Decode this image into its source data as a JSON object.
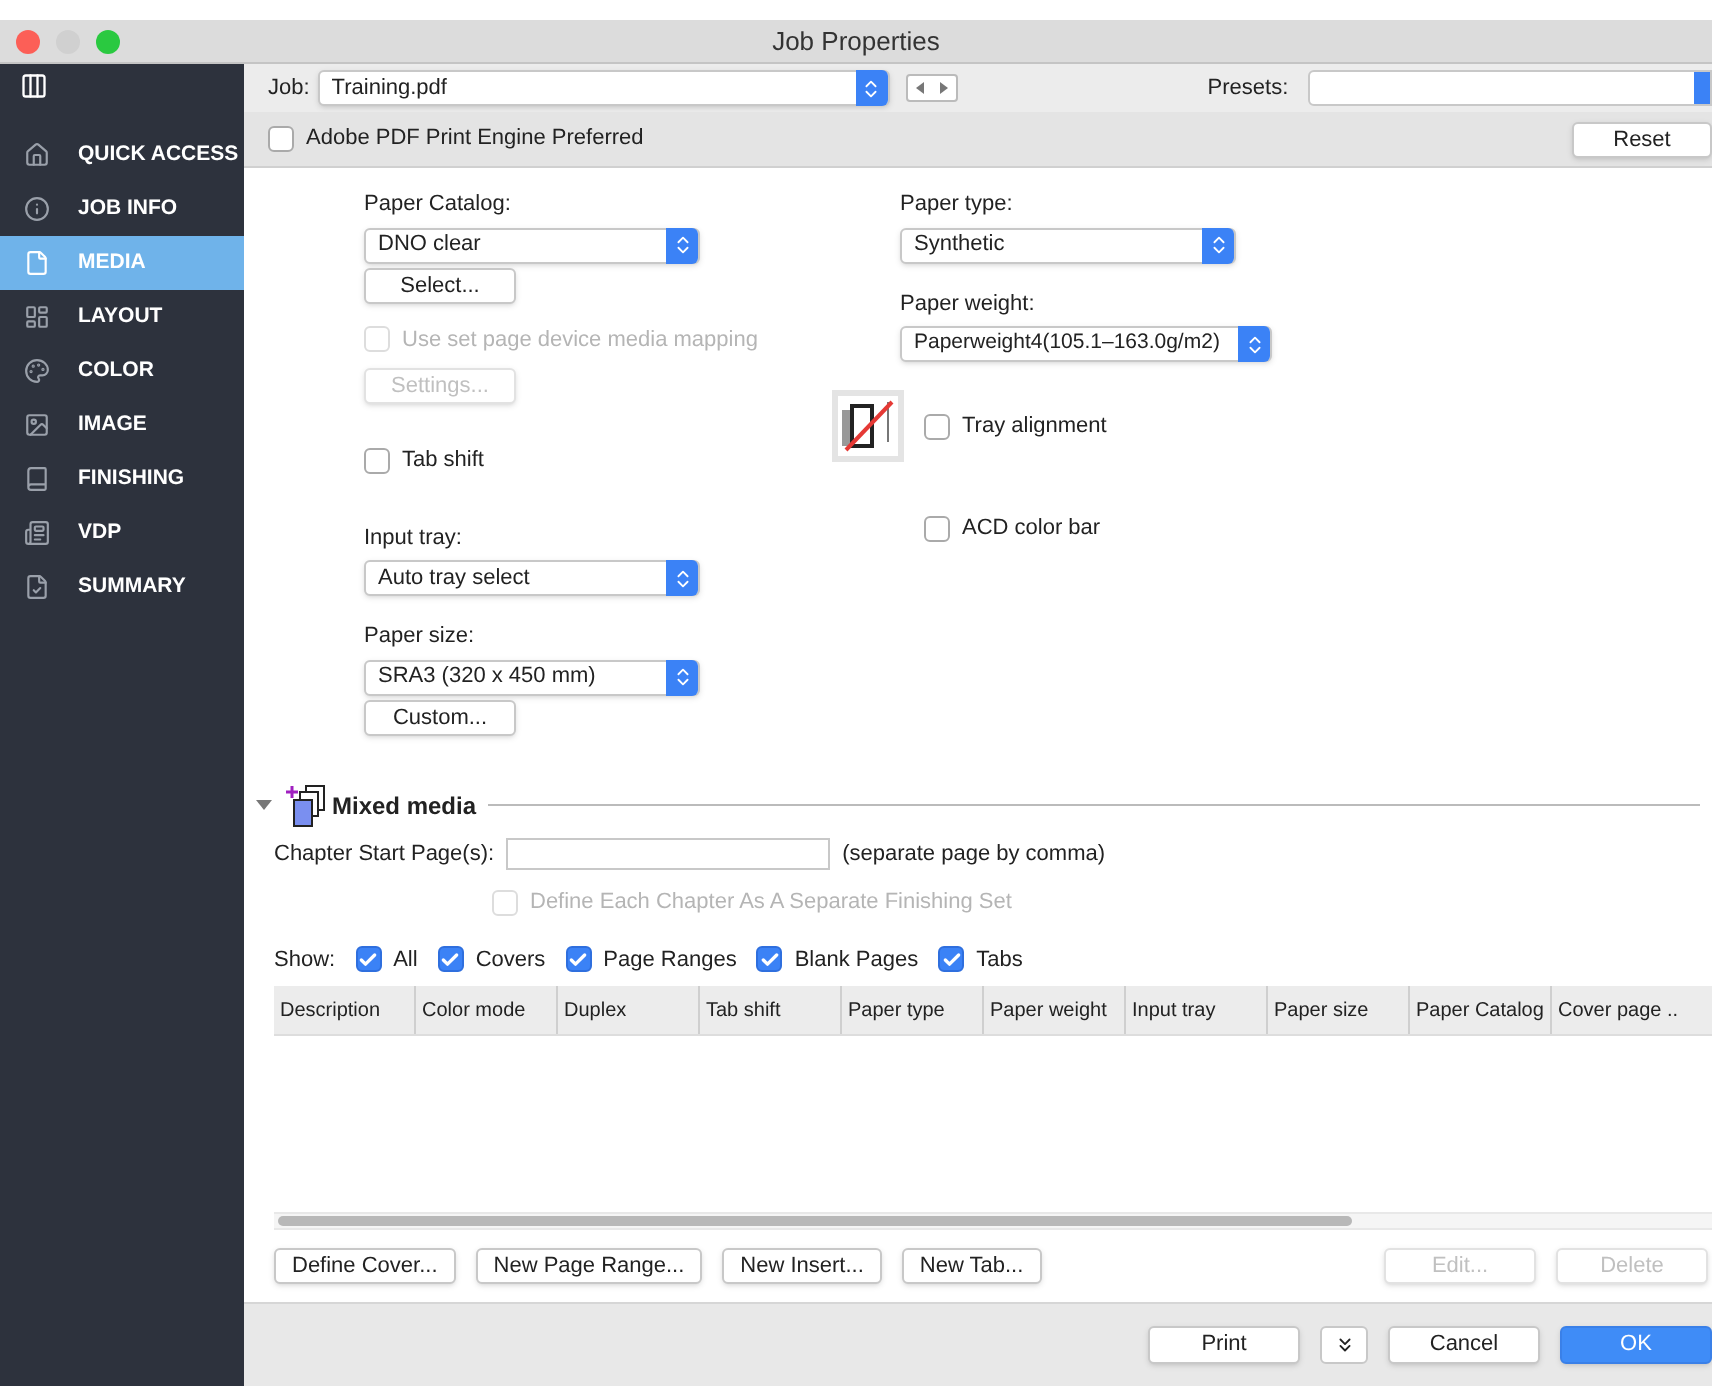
{
  "window": {
    "title": "Job Properties"
  },
  "sidebar": {
    "items": [
      {
        "label": "QUICK ACCESS",
        "selected": false
      },
      {
        "label": "JOB INFO",
        "selected": false
      },
      {
        "label": "MEDIA",
        "selected": true
      },
      {
        "label": "LAYOUT",
        "selected": false
      },
      {
        "label": "COLOR",
        "selected": false
      },
      {
        "label": "IMAGE",
        "selected": false
      },
      {
        "label": "FINISHING",
        "selected": false
      },
      {
        "label": "VDP",
        "selected": false
      },
      {
        "label": "SUMMARY",
        "selected": false
      }
    ]
  },
  "job": {
    "label": "Job:",
    "value": "Training.pdf"
  },
  "presets": {
    "label": "Presets:"
  },
  "pdf_engine": {
    "label": "Adobe PDF Print Engine Preferred",
    "checked": false
  },
  "reset_button": "Reset",
  "left": {
    "paper_catalog": {
      "label": "Paper Catalog:",
      "value": "DNO clear",
      "button": "Select..."
    },
    "device_mapping": {
      "label": "Use set page device media mapping",
      "checked": false,
      "disabled": true,
      "button": "Settings..."
    },
    "tab_shift": {
      "label": "Tab shift",
      "checked": false
    },
    "input_tray": {
      "label": "Input tray:",
      "value": "Auto tray select"
    },
    "paper_size": {
      "label": "Paper size:",
      "value": "SRA3 (320 x 450 mm)",
      "button": "Custom..."
    }
  },
  "right": {
    "paper_type": {
      "label": "Paper type:",
      "value": "Synthetic"
    },
    "paper_weight": {
      "label": "Paper weight:",
      "value": "Paperweight4(105.1–163.0g/m2)"
    },
    "tray_alignment": {
      "label": "Tray alignment",
      "checked": false
    },
    "acd_color_bar": {
      "label": "ACD color bar",
      "checked": false
    }
  },
  "mixed_media": {
    "title": "Mixed media",
    "expanded": true,
    "chapter": {
      "label": "Chapter Start Page(s):",
      "hint": "(separate page by comma)"
    },
    "finishing_set": {
      "label": "Define Each Chapter As A Separate Finishing Set",
      "checked": false,
      "disabled": true
    },
    "show_label": "Show:",
    "show": [
      {
        "label": "All",
        "checked": true
      },
      {
        "label": "Covers",
        "checked": true
      },
      {
        "label": "Page Ranges",
        "checked": true
      },
      {
        "label": "Blank Pages",
        "checked": true
      },
      {
        "label": "Tabs",
        "checked": true
      }
    ],
    "table": {
      "columns": [
        "Description",
        "Color mode",
        "Duplex",
        "Tab shift",
        "Paper type",
        "Paper weight",
        "Input tray",
        "Paper size",
        "Paper Catalog",
        "Cover page .."
      ]
    },
    "buttons": [
      {
        "label": "Define Cover...",
        "disabled": false
      },
      {
        "label": "New Page Range...",
        "disabled": false
      },
      {
        "label": "New Insert...",
        "disabled": false
      },
      {
        "label": "New Tab...",
        "disabled": false
      }
    ],
    "edit_buttons": [
      {
        "label": "Edit...",
        "disabled": true
      },
      {
        "label": "Delete",
        "disabled": true
      }
    ]
  },
  "footer": {
    "buttons": [
      {
        "label": "Print",
        "kind": "normal"
      },
      {
        "label": "Cancel",
        "kind": "normal"
      },
      {
        "label": "OK",
        "kind": "default"
      }
    ]
  }
}
